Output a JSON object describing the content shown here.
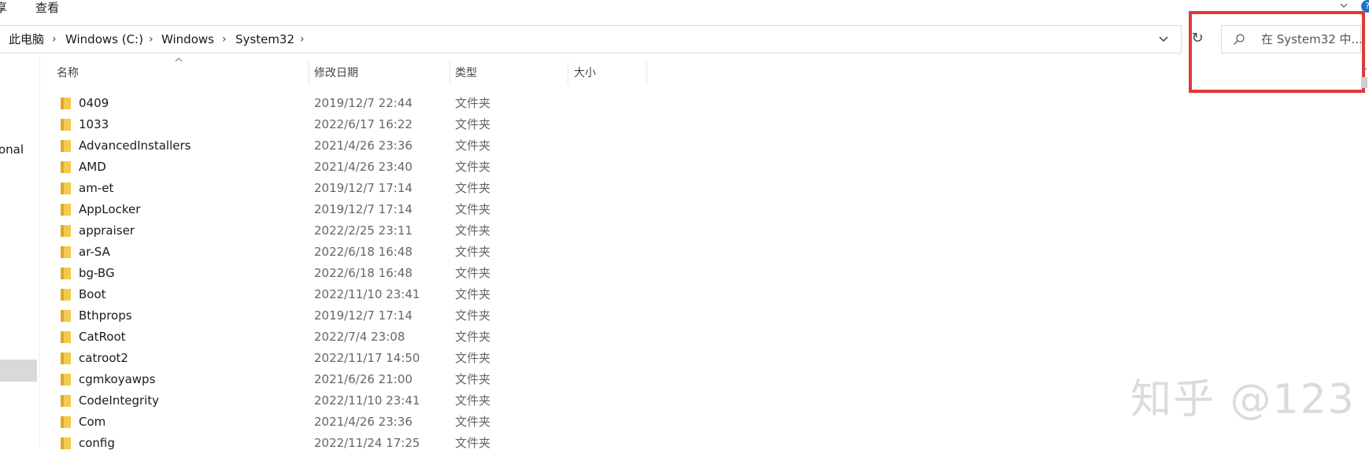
{
  "ribbon": {
    "tabs": [
      "享",
      "查看"
    ],
    "expand_icon": "chevron-down-icon",
    "help_icon": "help-icon",
    "help_label": "?"
  },
  "address_bar": {
    "root": "此电脑",
    "crumbs": [
      "Windows (C:)",
      "Windows",
      "System32"
    ],
    "refresh_glyph": "↻"
  },
  "search": {
    "placeholder": "在 System32 中..."
  },
  "nav": {
    "partial_item": "onal"
  },
  "columns": {
    "name": "名称",
    "modified": "修改日期",
    "type": "类型",
    "size": "大小"
  },
  "files": [
    {
      "name": "0409",
      "modified": "2019/12/7 22:44",
      "type": "文件夹"
    },
    {
      "name": "1033",
      "modified": "2022/6/17 16:22",
      "type": "文件夹"
    },
    {
      "name": "AdvancedInstallers",
      "modified": "2021/4/26 23:36",
      "type": "文件夹"
    },
    {
      "name": "AMD",
      "modified": "2021/4/26 23:40",
      "type": "文件夹"
    },
    {
      "name": "am-et",
      "modified": "2019/12/7 17:14",
      "type": "文件夹"
    },
    {
      "name": "AppLocker",
      "modified": "2019/12/7 17:14",
      "type": "文件夹"
    },
    {
      "name": "appraiser",
      "modified": "2022/2/25 23:11",
      "type": "文件夹"
    },
    {
      "name": "ar-SA",
      "modified": "2022/6/18 16:48",
      "type": "文件夹"
    },
    {
      "name": "bg-BG",
      "modified": "2022/6/18 16:48",
      "type": "文件夹"
    },
    {
      "name": "Boot",
      "modified": "2022/11/10 23:41",
      "type": "文件夹"
    },
    {
      "name": "Bthprops",
      "modified": "2019/12/7 17:14",
      "type": "文件夹"
    },
    {
      "name": "CatRoot",
      "modified": "2022/7/4 23:08",
      "type": "文件夹"
    },
    {
      "name": "catroot2",
      "modified": "2022/11/17 14:50",
      "type": "文件夹"
    },
    {
      "name": "cgmkoyawps",
      "modified": "2021/6/26 21:00",
      "type": "文件夹"
    },
    {
      "name": "CodeIntegrity",
      "modified": "2022/11/10 23:41",
      "type": "文件夹"
    },
    {
      "name": "Com",
      "modified": "2021/4/26 23:36",
      "type": "文件夹"
    },
    {
      "name": "config",
      "modified": "2022/11/24 17:25",
      "type": "文件夹"
    }
  ],
  "watermark": "知乎 @123",
  "colors": {
    "folder": "#f5c94c",
    "folder_dark": "#dfa82a",
    "highlight": "#e0393b"
  }
}
